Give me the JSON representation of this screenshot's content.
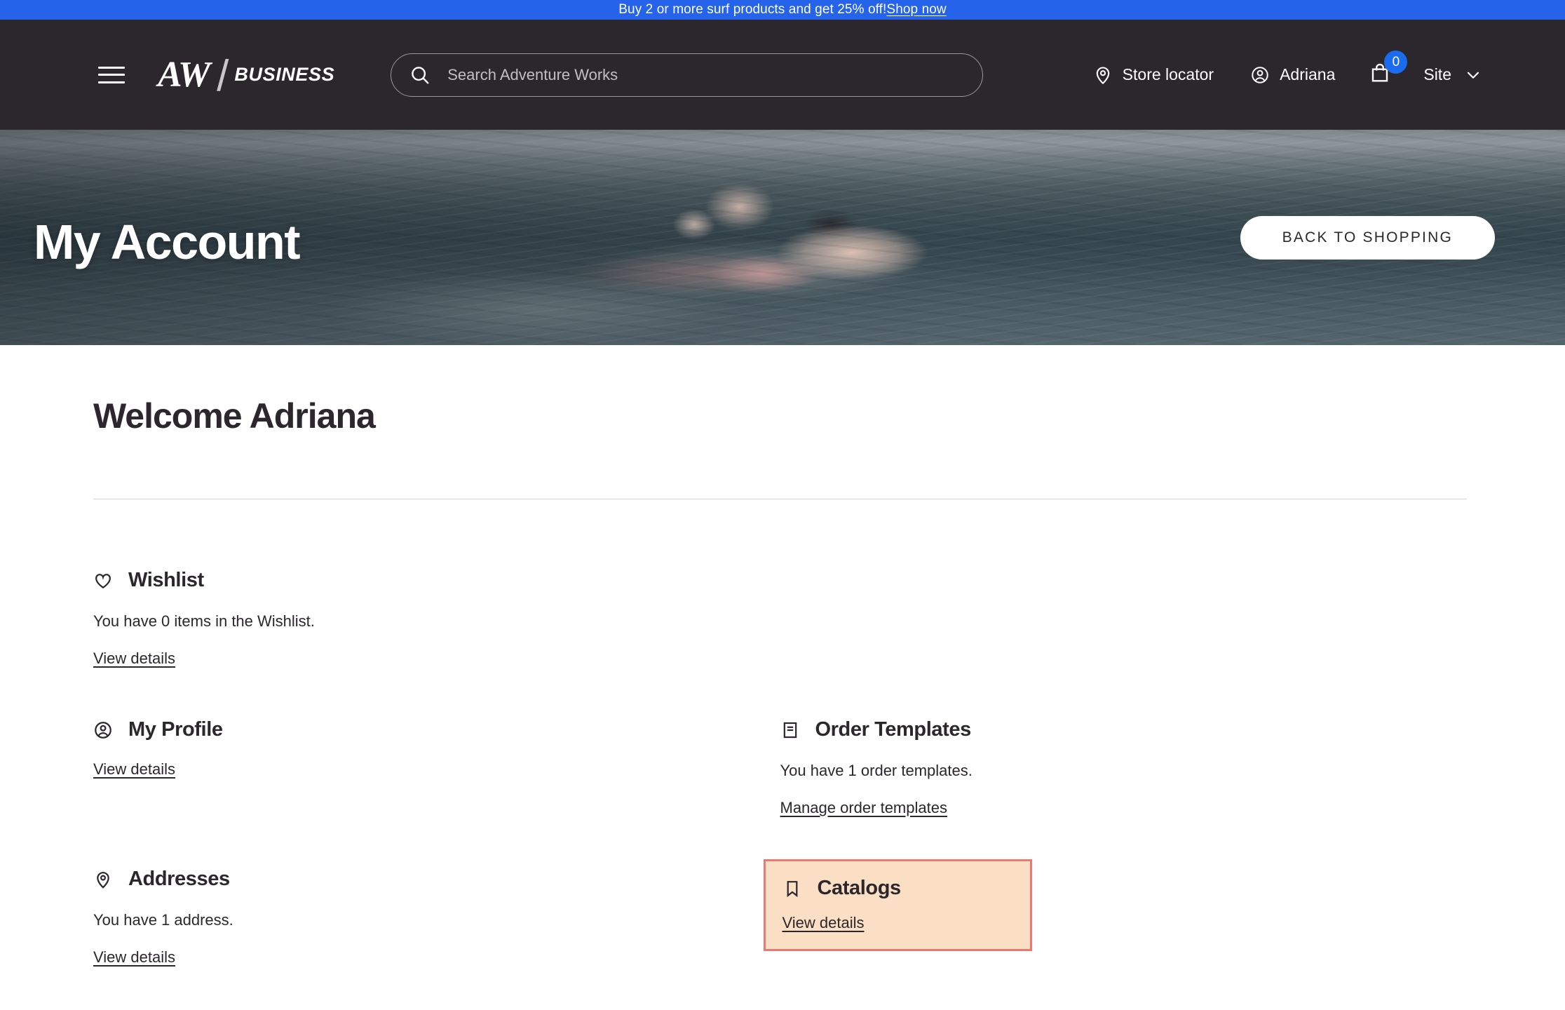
{
  "promo": {
    "text": "Buy 2 or more surf products and get 25% off! ",
    "link_label": "Shop now",
    "background_color": "#2563eb"
  },
  "header": {
    "background_color": "#2b272c",
    "menu_icon": "hamburger-icon",
    "logo": {
      "primary": "AW",
      "separator": "/",
      "secondary": "BUSINESS"
    },
    "search": {
      "placeholder": "Search Adventure Works",
      "value": "",
      "icon": "search-icon"
    },
    "store_locator": {
      "label": "Store locator",
      "icon": "location-pin-icon"
    },
    "account": {
      "label": "Adriana",
      "icon": "user-circle-icon"
    },
    "cart": {
      "icon": "shopping-bag-icon",
      "count": "0",
      "badge_color": "#1a6bee"
    },
    "site_selector": {
      "label": "Site",
      "icon": "chevron-down-icon"
    }
  },
  "hero": {
    "title": "My Account",
    "back_button_label": "BACK TO SHOPPING",
    "image_description": "swimmer-in-open-water"
  },
  "main": {
    "welcome_title": "Welcome Adriana",
    "tiles": [
      {
        "key": "wishlist",
        "icon": "heart-icon",
        "title": "Wishlist",
        "description": "You have 0 items in the Wishlist.",
        "link_label": "View details",
        "highlighted": false
      },
      {
        "key": "my-profile",
        "icon": "user-circle-icon",
        "title": "My Profile",
        "description": "",
        "link_label": "View details",
        "highlighted": false
      },
      {
        "key": "order-templates",
        "icon": "document-list-icon",
        "title": "Order Templates",
        "description": "You have 1 order templates.",
        "link_label": "Manage order templates",
        "highlighted": false
      },
      {
        "key": "addresses",
        "icon": "location-pin-icon",
        "title": "Addresses",
        "description": "You have 1 address.",
        "link_label": "View details",
        "highlighted": false
      },
      {
        "key": "catalogs",
        "icon": "bookmark-icon",
        "title": "Catalogs",
        "description": "",
        "link_label": "View details",
        "highlighted": true,
        "highlight_background": "#fbdfc4",
        "highlight_border": "#f1766d"
      }
    ]
  }
}
